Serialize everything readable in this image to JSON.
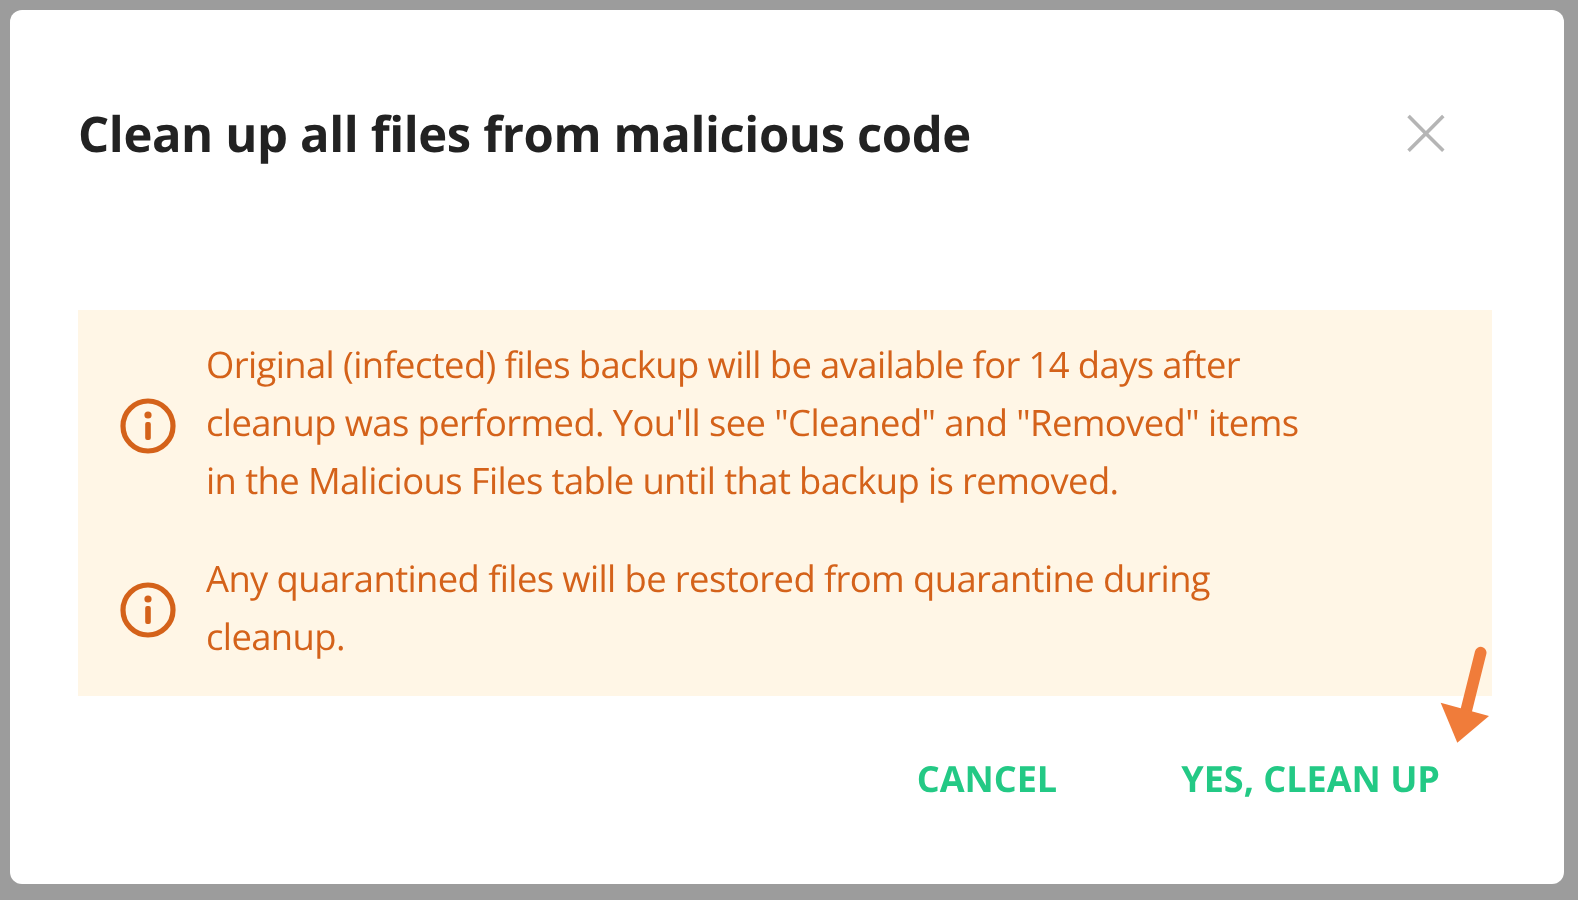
{
  "dialog": {
    "title": "Clean up all files from malicious code",
    "close": "×",
    "notices": [
      {
        "text": "Original (infected) files backup will be available for 14 days after cleanup was performed. You'll see \"Cleaned\" and \"Removed\" items in the Malicious Files table until that backup is removed."
      },
      {
        "text": "Any quarantined files will be restored from quarantine during cleanup."
      }
    ],
    "buttons": [
      "CANCEL",
      "YES, CLEAN UP"
    ]
  }
}
